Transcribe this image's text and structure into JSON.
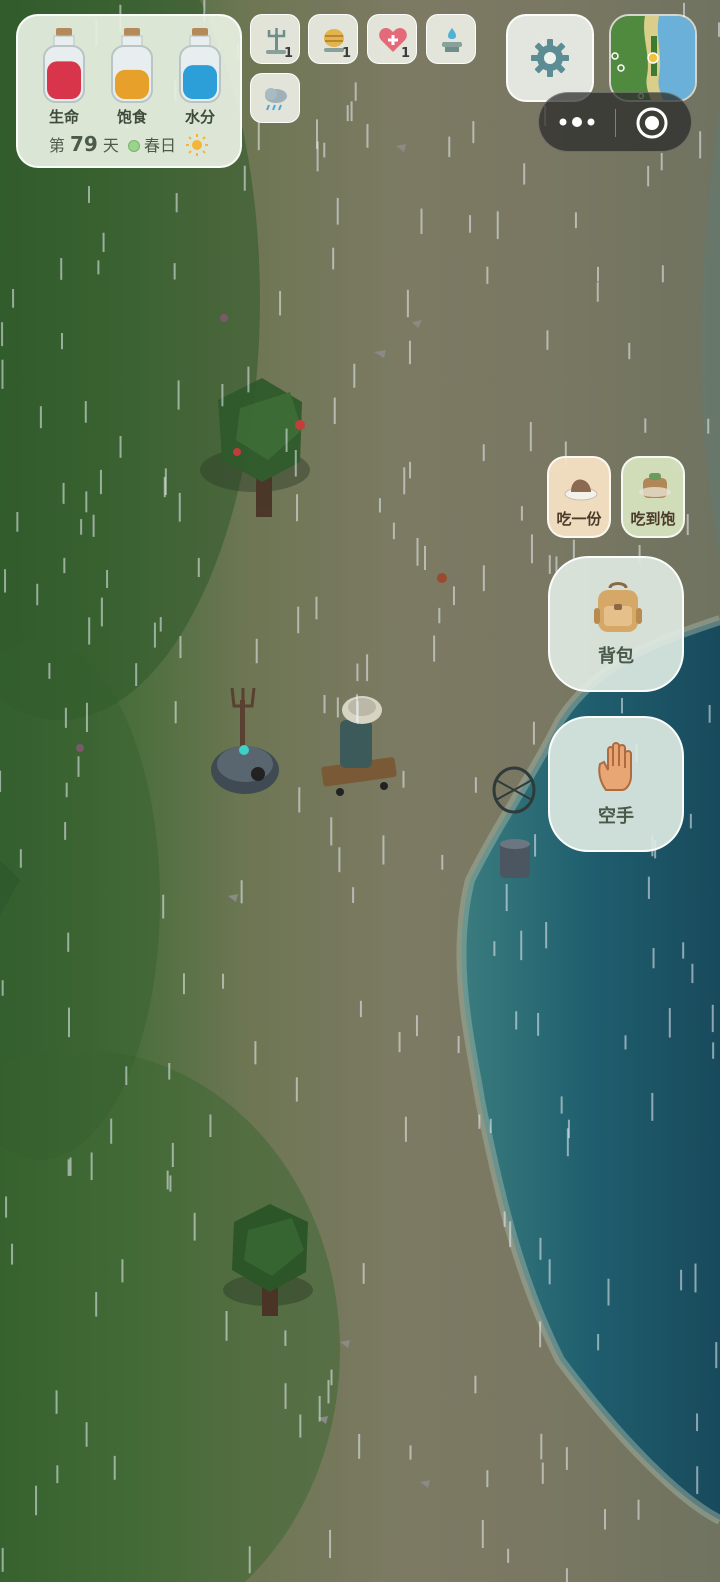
{
  "status": {
    "bars": [
      {
        "label": "生命",
        "level": 0.8,
        "color": "#d8354a"
      },
      {
        "label": "饱食",
        "level": 0.62,
        "color": "#e7a02a"
      },
      {
        "label": "水分",
        "level": 0.72,
        "color": "#2d9fd8"
      }
    ],
    "day_prefix": "第",
    "day_number": "79",
    "day_suffix": "天",
    "season": "春日",
    "weather_icon": "sun-icon"
  },
  "effects": [
    {
      "icon": "trident-icon",
      "count": "1"
    },
    {
      "icon": "beehive-icon",
      "count": "1"
    },
    {
      "icon": "heart-plus-icon",
      "count": "1"
    },
    {
      "icon": "fountain-icon",
      "count": ""
    },
    {
      "icon": "rain-cloud-icon",
      "count": ""
    }
  ],
  "actions": {
    "eat_one": "吃一份",
    "eat_full": "吃到饱",
    "backpack": "背包",
    "empty_hand": "空手"
  },
  "colors": {
    "grass": "#3f6a34",
    "sand": "#7b7a63",
    "sea": "#1f5e6e"
  }
}
